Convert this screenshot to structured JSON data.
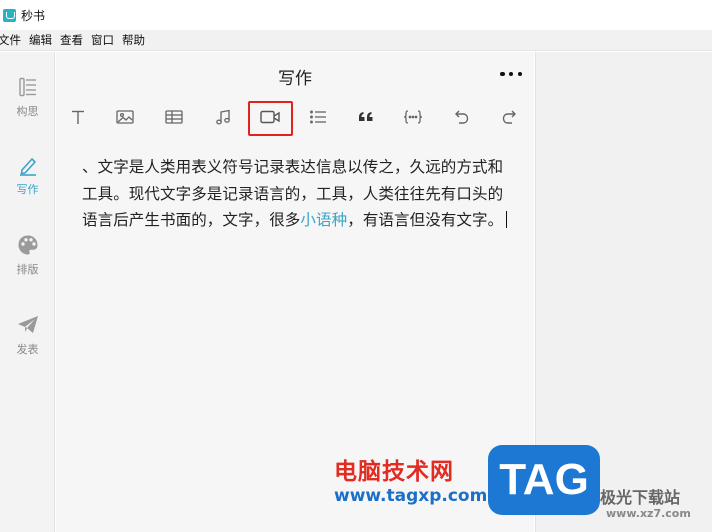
{
  "app": {
    "title": "秒书",
    "logo_color": "#25b3c6"
  },
  "menubar": {
    "items": [
      "文件",
      "编辑",
      "查看",
      "窗口",
      "帮助"
    ]
  },
  "sidebar": {
    "items": [
      {
        "label": "构思",
        "icon": "outline-icon",
        "active": false
      },
      {
        "label": "写作",
        "icon": "pen-icon",
        "active": true
      },
      {
        "label": "排版",
        "icon": "palette-icon",
        "active": false
      },
      {
        "label": "发表",
        "icon": "paper-plane-icon",
        "active": false
      }
    ]
  },
  "editor": {
    "title": "写作",
    "more_label": "•••",
    "toolbar": [
      "text-icon",
      "image-icon",
      "table-icon",
      "music-icon",
      "video-icon",
      "list-icon",
      "quote-icon",
      "code-block-icon",
      "undo-icon",
      "redo-icon"
    ],
    "highlighted_tool": "video-icon",
    "content": {
      "text_before": "、文字是人类用表义符号记录表达信息以传之，久远的方式和工具。现代文字多是记录语言的，工具，人类往往先有口头的语言后产生书面的，文字，很多",
      "link": "小语种",
      "text_after": "，有语言但没有文字。"
    }
  },
  "watermark": {
    "cn": "电脑技术网",
    "url": "www.tagxp.com",
    "tag": "TAG",
    "site": "极光下载站",
    "site_url": "www.xz7.com"
  },
  "colors": {
    "accent": "#3aa4c9",
    "highlight_border": "#e0231c"
  }
}
